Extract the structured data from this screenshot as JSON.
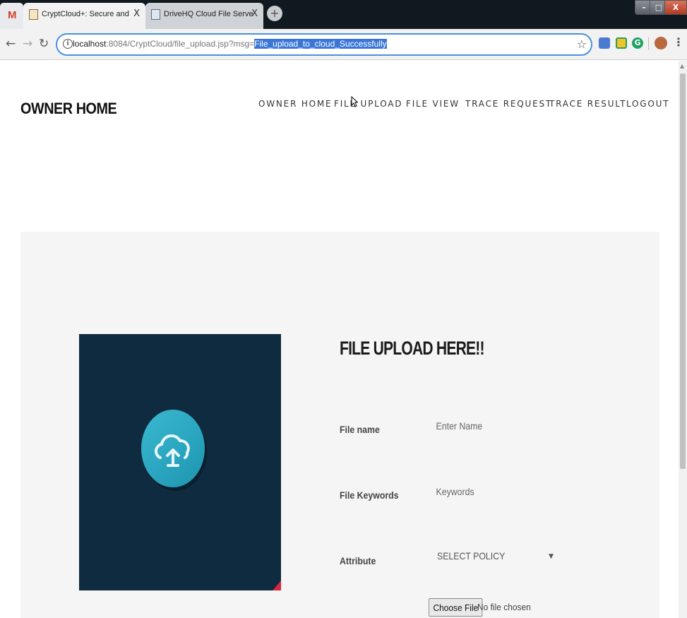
{
  "browser": {
    "gmail_tab_letter": "M",
    "tabs": [
      {
        "title": "CryptCloud+: Secure and Express",
        "close": "X"
      },
      {
        "title": "DriveHQ Cloud File Server, Drive",
        "close": "X"
      }
    ],
    "new_tab": "+",
    "window_controls": {
      "minimize": "–",
      "maximize": "□",
      "close": "X"
    },
    "url": {
      "host": "localhost",
      "rest": ":8084/CryptCloud/file_upload.jsp?msg=",
      "selected": "File_upload_to_cloud_Successfully"
    },
    "star": "☆",
    "extension_grammarly": "G",
    "menu": "⋮"
  },
  "site": {
    "brand": "OWNER HOME",
    "nav": [
      "OWNER HOME",
      "FILE UPLOAD",
      "FILE VIEW",
      "TRACE REQUEST",
      "TRACE RESULT",
      "LOGOUT"
    ]
  },
  "form": {
    "title": "FILE UPLOAD HERE!!",
    "fields": [
      {
        "label": "File name",
        "placeholder": "Enter Name"
      },
      {
        "label": "File Keywords",
        "placeholder": "Keywords"
      }
    ],
    "attribute": {
      "label": "Attribute",
      "selected": "SELECT POLICY"
    },
    "file": {
      "button": "Choose File",
      "status": "No file chosen"
    }
  },
  "icons": {
    "hero": "cloud-upload-icon",
    "info": "info-icon",
    "back": "back-arrow-icon",
    "forward": "forward-arrow-icon",
    "reload": "reload-icon"
  }
}
